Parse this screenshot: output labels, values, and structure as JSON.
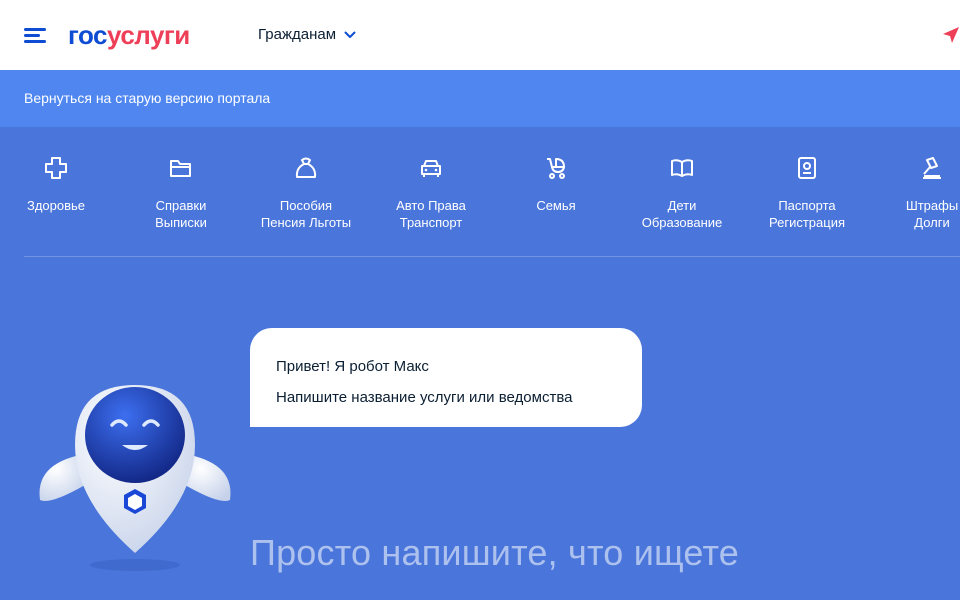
{
  "header": {
    "logo_part1": "гос",
    "logo_part2": "услуги",
    "role_label": "Гражданам"
  },
  "banner": {
    "link_text": "Вернуться на старую версию портала"
  },
  "categories": [
    {
      "icon": "plus-icon",
      "line1": "Здоровье",
      "line2": ""
    },
    {
      "icon": "folder-icon",
      "line1": "Справки",
      "line2": "Выписки"
    },
    {
      "icon": "bag-icon",
      "line1": "Пособия",
      "line2": "Пенсия Льготы"
    },
    {
      "icon": "car-icon",
      "line1": "Авто Права",
      "line2": "Транспорт"
    },
    {
      "icon": "stroller-icon",
      "line1": "Семья",
      "line2": ""
    },
    {
      "icon": "book-icon",
      "line1": "Дети",
      "line2": "Образование"
    },
    {
      "icon": "passport-icon",
      "line1": "Паспорта",
      "line2": "Регистрация"
    },
    {
      "icon": "gavel-icon",
      "line1": "Штрафы",
      "line2": "Долги"
    }
  ],
  "chat": {
    "greeting": "Привет! Я робот Макс",
    "prompt": "Напишите название услуги или ведомства"
  },
  "search": {
    "placeholder": "Просто напишите, что ищете"
  },
  "colors": {
    "brand_blue": "#0d4cd3",
    "brand_red": "#ee3f58",
    "banner_bg": "#4f86f0",
    "page_bg": "#4a75da"
  }
}
